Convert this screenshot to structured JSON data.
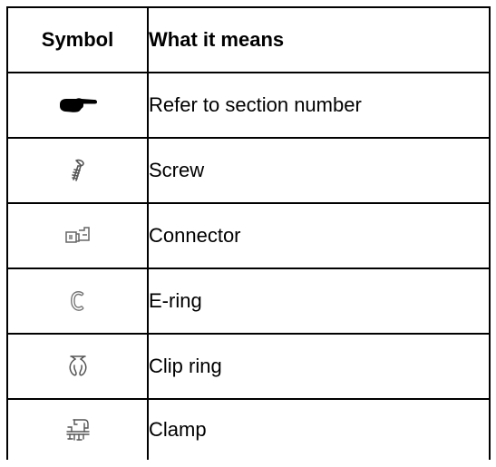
{
  "table": {
    "header": {
      "symbol": "Symbol",
      "meaning": "What it means"
    },
    "rows": [
      {
        "icon": "pointing-hand-icon",
        "meaning": "Refer to section number"
      },
      {
        "icon": "screw-icon",
        "meaning": "Screw"
      },
      {
        "icon": "connector-icon",
        "meaning": "Connector"
      },
      {
        "icon": "e-ring-icon",
        "meaning": "E-ring"
      },
      {
        "icon": "clip-ring-icon",
        "meaning": "Clip ring"
      },
      {
        "icon": "clamp-icon",
        "meaning": "Clamp"
      }
    ]
  }
}
